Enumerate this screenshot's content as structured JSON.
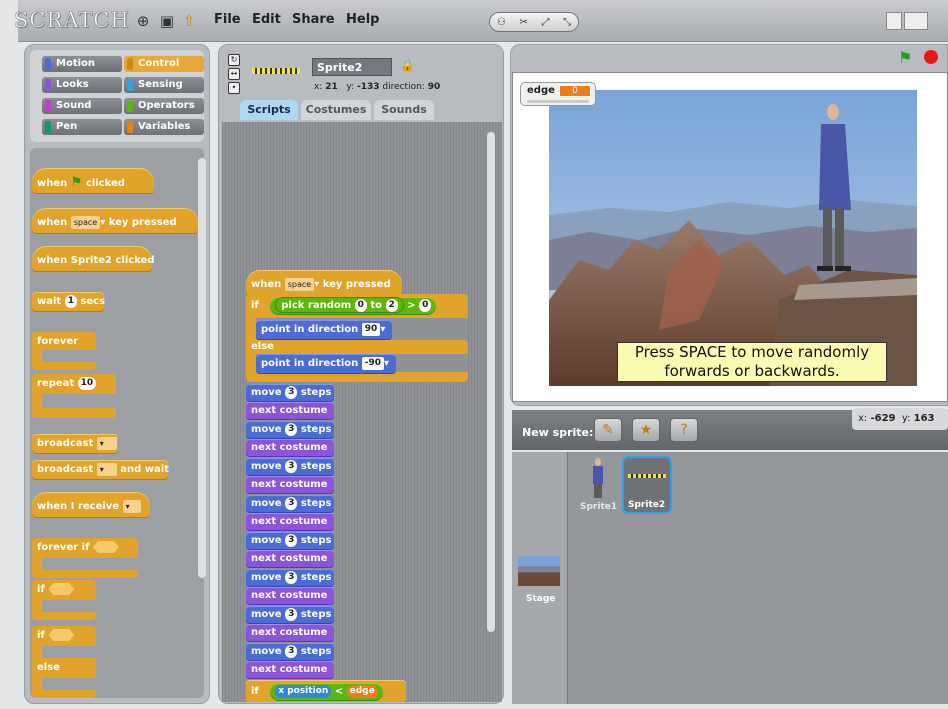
{
  "app": {
    "logo": "SCRATCH"
  },
  "menu": [
    "File",
    "Edit",
    "Share",
    "Help"
  ],
  "categories": [
    {
      "label": "Motion",
      "color": "#4a6cd4"
    },
    {
      "label": "Control",
      "color": "#e1a329"
    },
    {
      "label": "Looks",
      "color": "#8a55d7"
    },
    {
      "label": "Sensing",
      "color": "#2ca5e2"
    },
    {
      "label": "Sound",
      "color": "#bb42c3"
    },
    {
      "label": "Operators",
      "color": "#5cb712"
    },
    {
      "label": "Pen",
      "color": "#0e9a6c"
    },
    {
      "label": "Variables",
      "color": "#ee7d16"
    }
  ],
  "palette": {
    "when_flag": "when",
    "clicked": "clicked",
    "when_key": "when",
    "key_space": "space",
    "key_pressed": "key pressed",
    "when_sprite": "when Sprite2 clicked",
    "wait": "wait",
    "wait_num": "1",
    "secs": "secs",
    "forever": "forever",
    "repeat": "repeat",
    "repeat_num": "10",
    "broadcast": "broadcast",
    "broadcast_wait": "broadcast",
    "and_wait": "and wait",
    "when_receive": "when I receive",
    "forever_if": "forever if",
    "if1": "if",
    "if2": "if",
    "else": "else"
  },
  "sprite": {
    "name": "Sprite2",
    "x_label": "x:",
    "x": "21",
    "y_label": "y:",
    "y": "-133",
    "direction_label": "direction:",
    "direction": "90"
  },
  "tabs": [
    "Scripts",
    "Costumes",
    "Sounds"
  ],
  "script": {
    "when": "when",
    "key": "space",
    "key_pressed": "key pressed",
    "if": "if",
    "pick_random": "pick random",
    "r_from": "0",
    "to": "to",
    "r_to": "2",
    "gt": ">",
    "cmp": "0",
    "point_dir": "point in direction",
    "dir1": "90",
    "else": "else",
    "dir2": "-90",
    "move": "move",
    "steps_n": "3",
    "steps": "steps",
    "next_costume": "next costume",
    "if2": "if",
    "x_position": "x position",
    "lt": "<",
    "edge": "edge"
  },
  "stage": {
    "var_name": "edge",
    "var_value": "0",
    "caption_line1": "Press SPACE to move randomly",
    "caption_line2": "forwards or backwards."
  },
  "sprites_panel": {
    "new_sprite": "New sprite:",
    "x_label": "x:",
    "mouse_x": "-629",
    "y_label": "y:",
    "mouse_y": "163",
    "sprite1": "Sprite1",
    "sprite2": "Sprite2",
    "stage": "Stage"
  }
}
